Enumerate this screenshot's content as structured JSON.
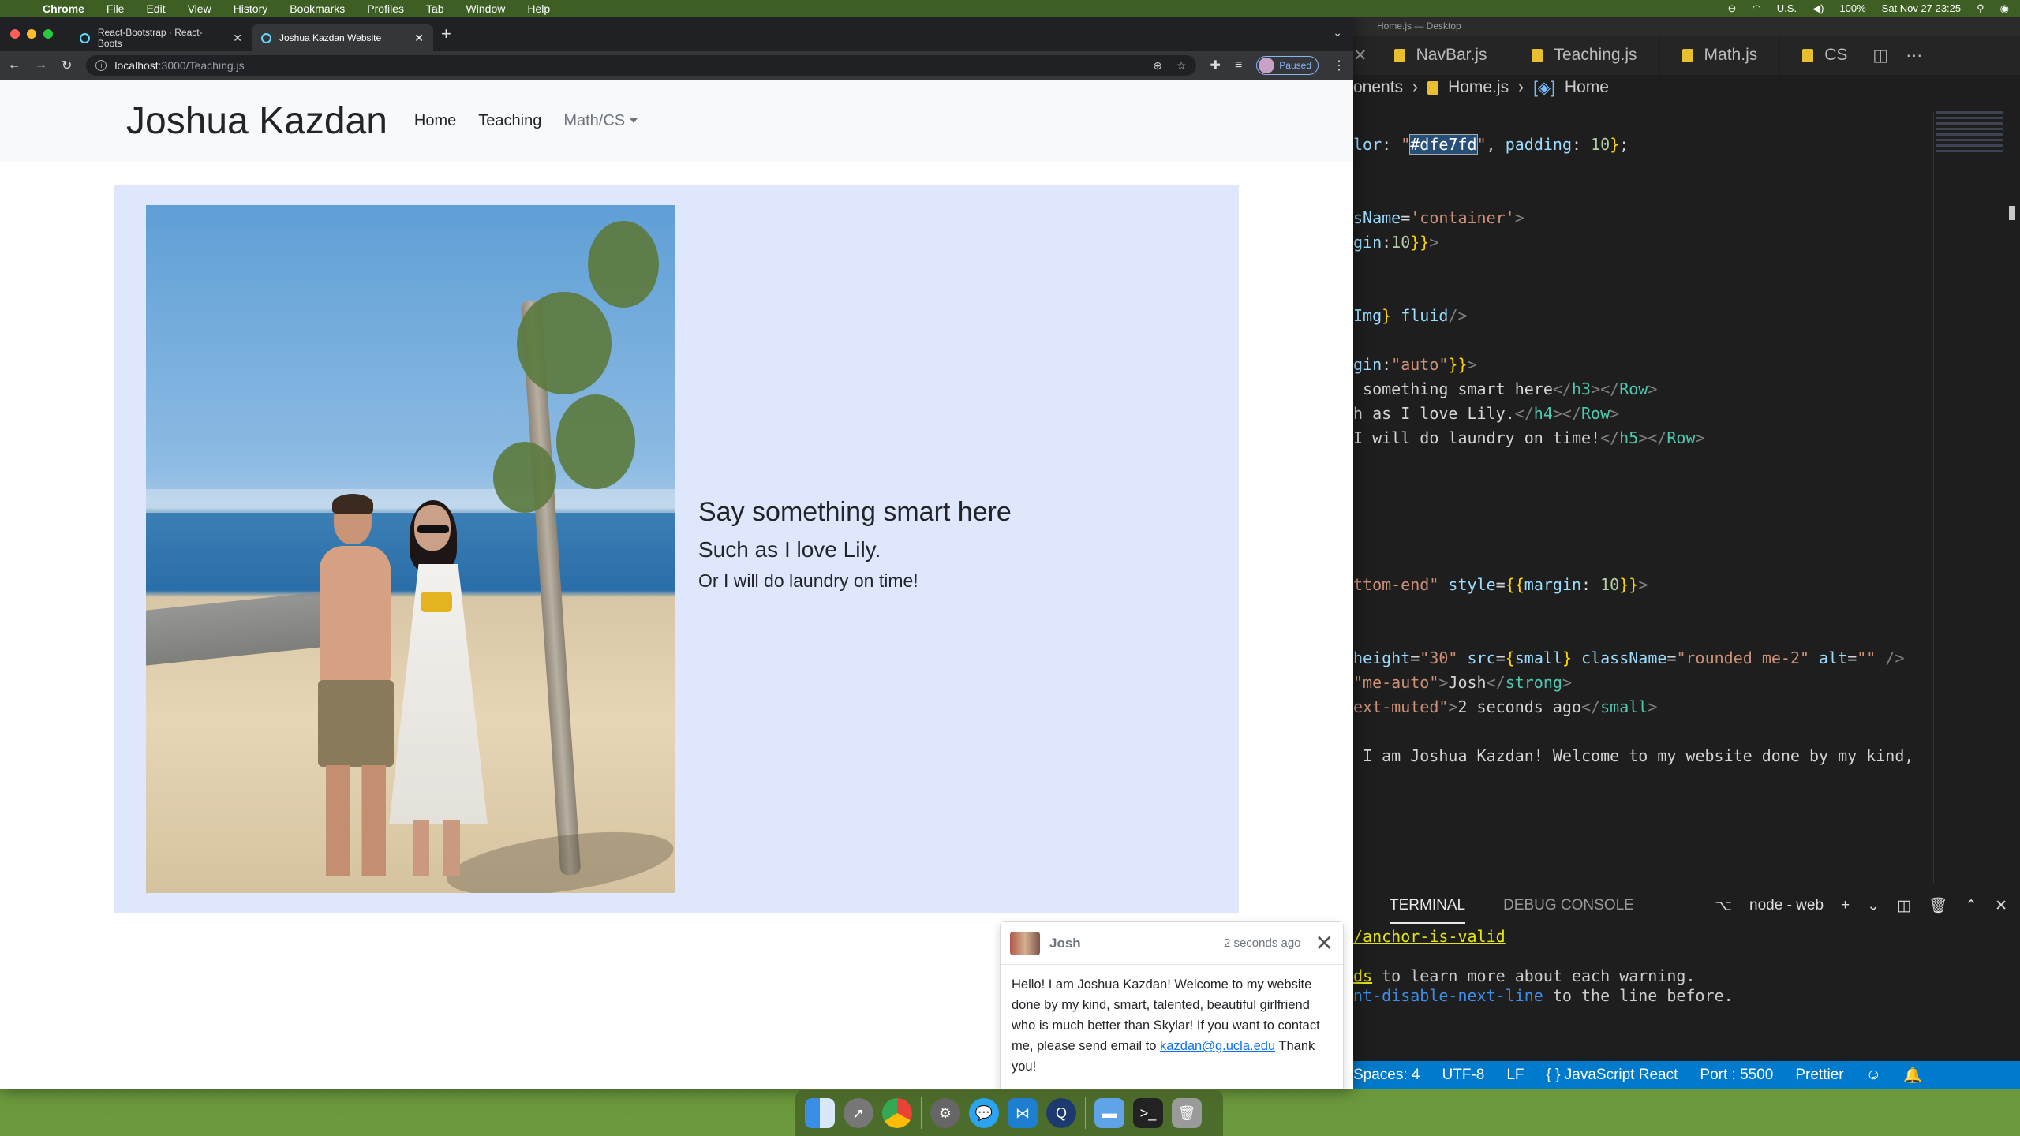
{
  "menubar": {
    "app": "Chrome",
    "items": [
      "File",
      "Edit",
      "View",
      "History",
      "Bookmarks",
      "Profiles",
      "Tab",
      "Window",
      "Help"
    ],
    "right": {
      "input": "U.S.",
      "battery": "100%",
      "datetime": "Sat Nov 27  23:25"
    }
  },
  "chrome": {
    "tabs": [
      {
        "title": "React-Bootstrap · React-Boots"
      },
      {
        "title": "Joshua Kazdan Website"
      }
    ],
    "url_host": "localhost",
    "url_path": ":3000/Teaching.js",
    "profile_status": "Paused"
  },
  "site": {
    "brand": "Joshua Kazdan",
    "nav": {
      "home": "Home",
      "teaching": "Teaching",
      "mathcs": "Math/CS"
    },
    "heading_h3": "Say something smart here",
    "heading_h4": "Such as I love Lily.",
    "heading_h5": "Or I will do laundry on time!",
    "container_bg": "#dfe7fd"
  },
  "toast": {
    "name": "Josh",
    "time": "2 seconds ago",
    "body_pre": "Hello! I am Joshua Kazdan! Welcome to my website done by my kind, smart, talented, beautiful girlfriend who is much better than Skylar! If you want to contact me, please send email to ",
    "email": "kazdan@g.ucla.edu",
    "body_post": " Thank you!"
  },
  "vscode": {
    "window_title": "Home.js — Desktop",
    "tabs": [
      "NavBar.js",
      "Teaching.js",
      "Math.js",
      "CS"
    ],
    "breadcrumb": {
      "folder": "onents",
      "file": "Home.js",
      "symbol": "Home"
    },
    "panel_tabs": {
      "terminal": "TERMINAL",
      "debug": "DEBUG CONSOLE"
    },
    "terminal_name": "node - web",
    "terminal_lines": {
      "l1": "/anchor-is-valid",
      "l2a": "ds",
      "l2b": " to learn more about each warning.",
      "l3a": "nt-disable-next-line",
      "l3b": " to the line before."
    },
    "status": {
      "spaces": "Spaces: 4",
      "encoding": "UTF-8",
      "eol": "LF",
      "lang": "{ } JavaScript React",
      "port": "Port : 5500",
      "prettier": "Prettier"
    }
  },
  "colors": {
    "accent": "#007acc",
    "link": "#0d6efd"
  }
}
